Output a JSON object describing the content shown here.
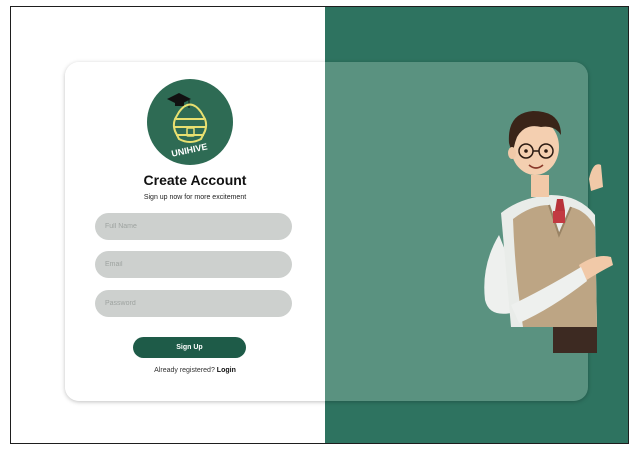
{
  "logo": {
    "text": "UNIHIVE",
    "icon": "beehive-graduation-cap-icon"
  },
  "form": {
    "title": "Create Account",
    "subtitle": "Sign up now for more excitement",
    "fields": {
      "full_name": {
        "value": "",
        "placeholder": "Full Name"
      },
      "email": {
        "value": "",
        "placeholder": "Email"
      },
      "password": {
        "value": "",
        "placeholder": "Password"
      }
    },
    "submit_label": "Sign Up",
    "login_prompt": "Already registered?",
    "login_link": "Login"
  },
  "illustration": {
    "subject": "student-pointing"
  },
  "colors": {
    "dark_green": "#2e7360",
    "card_green_overlay": "#5a9280",
    "button": "#1e5b48",
    "field_bg": "#cdd0ce",
    "logo_yellow": "#e8e070"
  }
}
